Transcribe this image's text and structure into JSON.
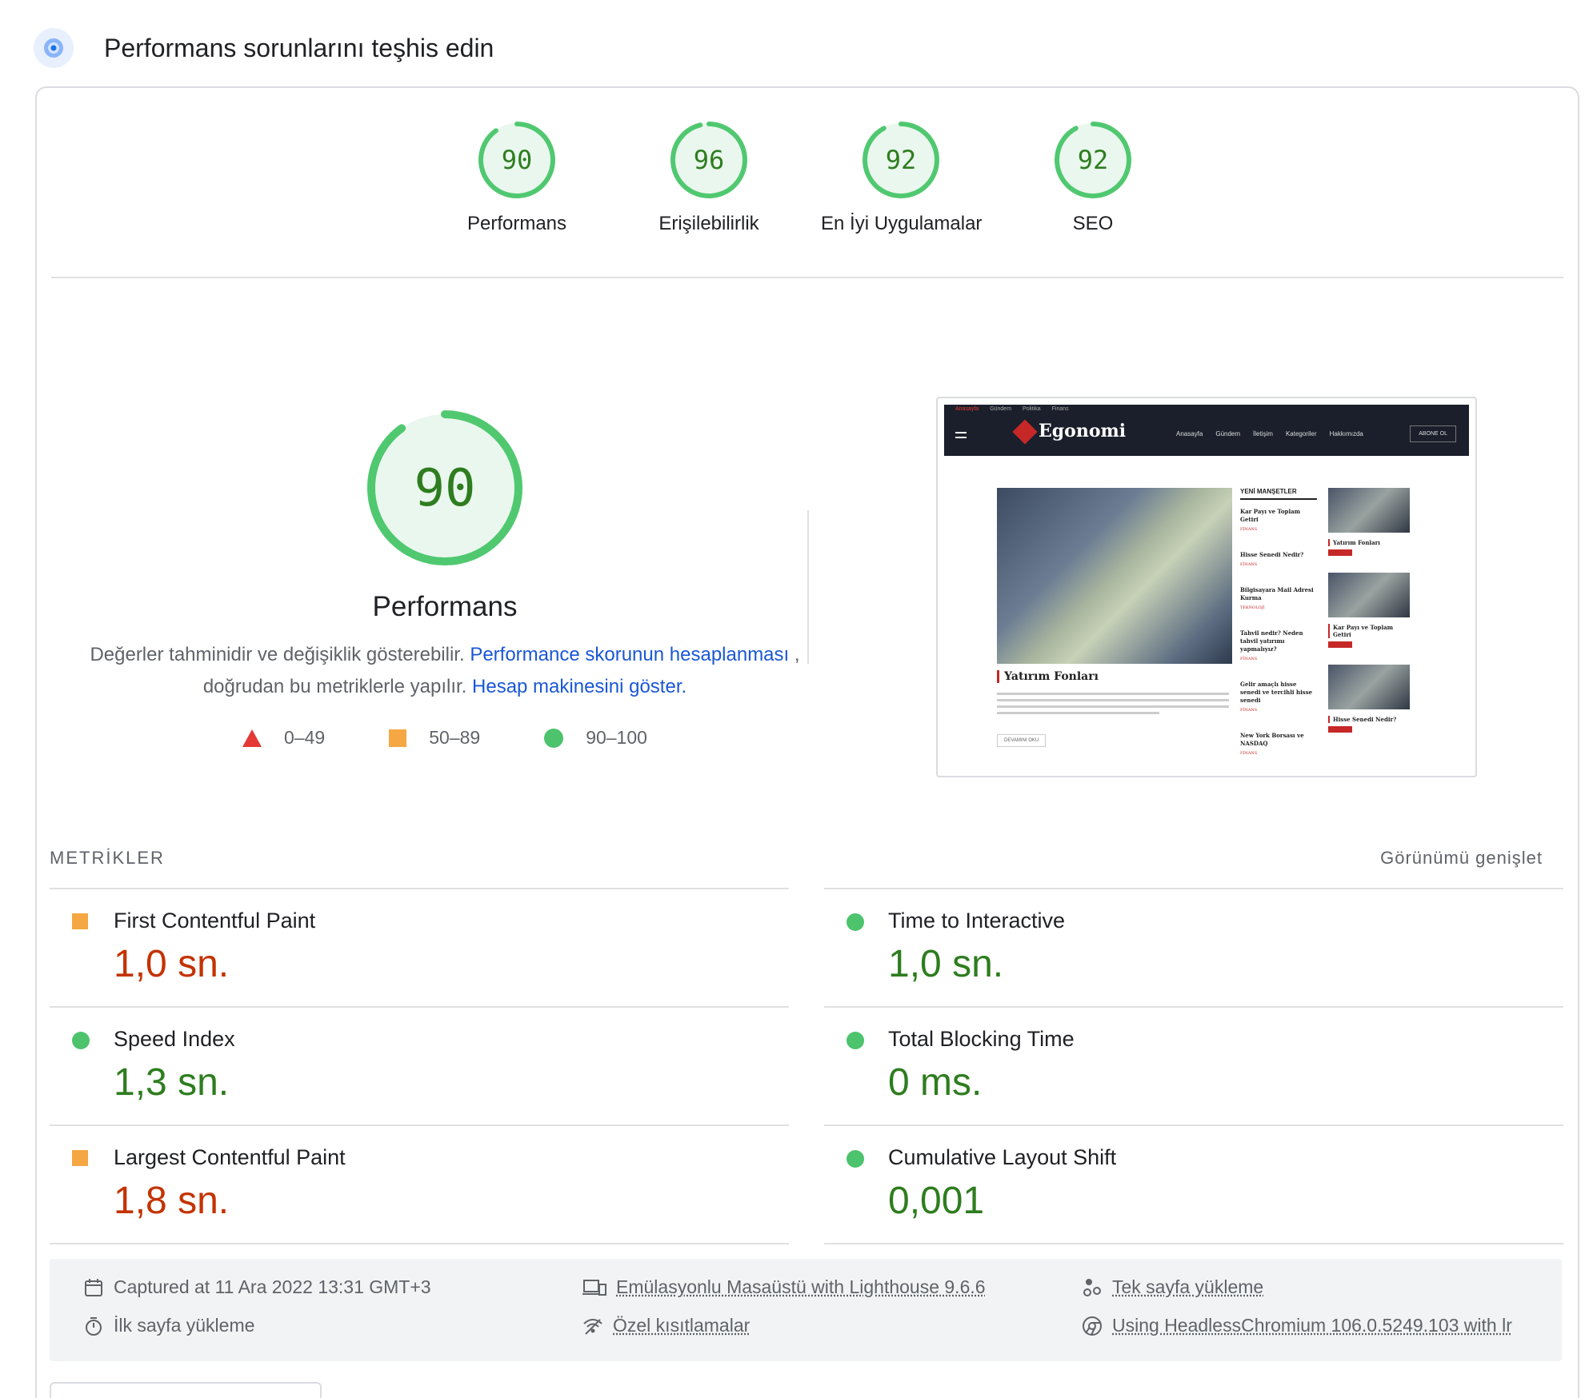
{
  "header": {
    "title": "Performans sorunlarını teşhis edin",
    "icon": "lighthouse-target-icon"
  },
  "scores": [
    {
      "value": "90",
      "label": "Performans",
      "fraction": 0.9
    },
    {
      "value": "96",
      "label": "Erişilebilirlik",
      "fraction": 0.96
    },
    {
      "value": "92",
      "label": "En İyi Uygulamalar",
      "fraction": 0.92
    },
    {
      "value": "92",
      "label": "SEO",
      "fraction": 0.92
    }
  ],
  "main_score": {
    "value": "90",
    "fraction": 0.9,
    "title": "Performans",
    "desc_prefix": "Değerler tahminidir ve değişiklik gösterebilir.",
    "desc_link1": "Performance skorunun hesaplanması",
    "desc_middle": ", doğrudan bu metriklerle yapılır.",
    "desc_link2": "Hesap makinesini göster."
  },
  "legend": [
    {
      "range": "0–49",
      "shape": "triangle",
      "color": "#e53935"
    },
    {
      "range": "50–89",
      "shape": "square",
      "color": "#f4a742"
    },
    {
      "range": "90–100",
      "shape": "circle",
      "color": "#4cc36c"
    }
  ],
  "thumbnail": {
    "top_links": [
      "Anasayfa",
      "Gündem",
      "Politika",
      "Finans"
    ],
    "logo": "Egonomi",
    "menu": [
      "Anasayfa",
      "Gündem",
      "İletişim",
      "Kategoriler",
      "Hakkımızda"
    ],
    "subscribe": "ABONE OL",
    "hero_title": "Yatırım Fonları",
    "read_more": "DEVAMINI OKU",
    "yeni_heading": "YENİ MANŞETLER",
    "yeni_items": [
      "Kar Payı ve Toplam Getiri",
      "Hisse Senedi Nedir?",
      "Bilgisayara Mail Adresi Kurma",
      "Tahvil nedir? Neden tahvil yatırımı yapmalıyız?",
      "Gelir amaçlı hisse senedi ve tercihli hisse senedi",
      "New York Borsası ve NASDAQ"
    ],
    "side_items": [
      "Yatırım Fonları",
      "Kar Payı ve Toplam Getiri",
      "Hisse Senedi Nedir?"
    ]
  },
  "metrics": {
    "heading": "METRİKLER",
    "toggle": "Görünümü genişlet",
    "items": [
      {
        "name": "First Contentful Paint",
        "value": "1,0 sn.",
        "status": "average"
      },
      {
        "name": "Time to Interactive",
        "value": "1,0 sn.",
        "status": "pass"
      },
      {
        "name": "Speed Index",
        "value": "1,3 sn.",
        "status": "pass"
      },
      {
        "name": "Total Blocking Time",
        "value": "0 ms.",
        "status": "pass"
      },
      {
        "name": "Largest Contentful Paint",
        "value": "1,8 sn.",
        "status": "average"
      },
      {
        "name": "Cumulative Layout Shift",
        "value": "0,001",
        "status": "pass"
      }
    ]
  },
  "runtime_info": {
    "captured": "Captured at 11 Ara 2022 13:31 GMT+3",
    "initial_load": "İlk sayfa yükleme",
    "emulation": "Emülasyonlu Masaüstü with Lighthouse 9.6.6",
    "throttling": "Özel kısıtlamalar",
    "single_load": "Tek sayfa yükleme",
    "browser": "Using HeadlessChromium 106.0.5249.103 with lr"
  },
  "colors": {
    "pass": "#0cce6b",
    "average": "#ffa400",
    "fail": "#ff4e42",
    "link": "#1a57d6"
  }
}
